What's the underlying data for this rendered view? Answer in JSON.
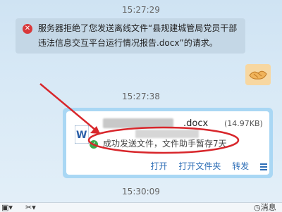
{
  "messages": {
    "timestamp_1": "15:27:29",
    "timestamp_2": "15:27:38",
    "timestamp_3": "15:30:09",
    "error_notice": "服务器拒绝了您发送离线文件“县规建城管局党员干部违法信息交互平台运行情况报告.docx”的请求。"
  },
  "file_card": {
    "extension": "docx",
    "size": "(14.97KB)",
    "status": "成功发送文件，文件助手暂存7天",
    "actions": [
      "打开",
      "打开文件夹",
      "转发"
    ]
  },
  "bottom_bar": {
    "right_label": "消息"
  },
  "colors": {
    "annotation_red": "#d8262b",
    "link_blue": "#2c6db6",
    "bubble_border": "#a9d7f4"
  }
}
